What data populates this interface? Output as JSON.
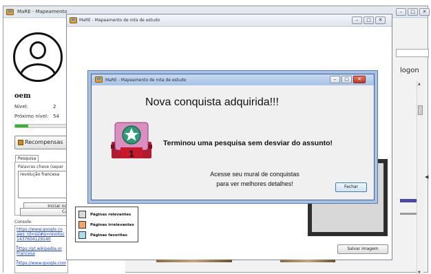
{
  "main_window": {
    "title": "MaRE - Mapeamento",
    "controls": [
      "–",
      "□",
      "✕"
    ]
  },
  "left_panel": {
    "username": "oem",
    "level_label": "Nível:",
    "level_value": "2",
    "next_level_label": "Próximo nível:",
    "next_level_value": "54",
    "xp_progress": 0.24,
    "rewards_button": "Recompensas",
    "search_tab": "Pesquisa",
    "keywords_label": "Palavras chave (separ",
    "keywords_value": "revolução francesa",
    "start_button": "Iniciar no",
    "cancel_button": "Ca",
    "console_label": "Console:",
    "console_lines": [
      "https://www.google.co",
      "aws_rd=ssl#q=revoluç",
      "1437604129140",
      "",
      "https://pt.wikipedia.or",
      "Francesa",
      "",
      "https://www.google.com.br/"
    ]
  },
  "right_strip": {
    "logon_label": "logon"
  },
  "route_window": {
    "title": "MaRE - Mapeamento de rota de estudo",
    "controls": [
      "–",
      "□",
      "✕"
    ],
    "legend": [
      {
        "label": "Páginas relevantes",
        "color": "#d9d9d9"
      },
      {
        "label": "Páginas irrelevantes",
        "color": "#f2a46b"
      },
      {
        "label": "Páginas favoritas",
        "color": "#a9dcea"
      }
    ],
    "save_image_button": "Salvar imagem",
    "dark_panel_close": "✕"
  },
  "achievement_dialog": {
    "title": "MaRE - Mapeamento de rota de estudo",
    "heading": "Nova conquista adquirida!!!",
    "badge_number": "1",
    "achievement": "Terminou uma pesquisa sem desviar do assunto!",
    "mural_line1": "Acesse seu mural de conquistas",
    "mural_line2": "para ver melhores detalhes!",
    "close_button": "Fechar",
    "controls": [
      "–",
      "□",
      "✕"
    ]
  }
}
